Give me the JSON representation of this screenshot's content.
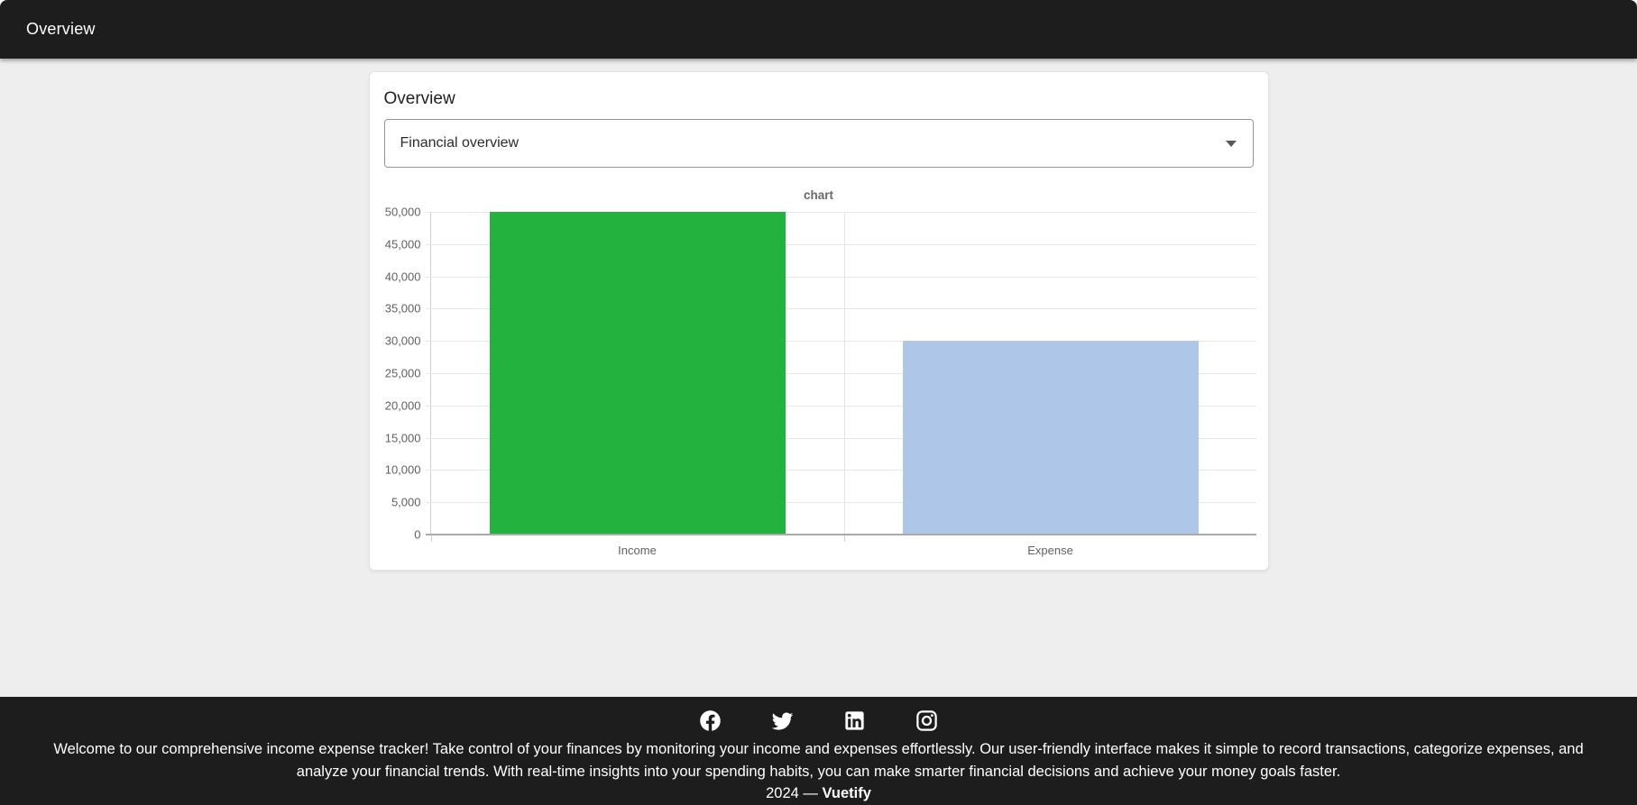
{
  "app_bar": {
    "title": "Overview"
  },
  "card": {
    "title": "Overview",
    "select": {
      "value": "Financial overview"
    }
  },
  "chart_data": {
    "type": "bar",
    "title": "chart",
    "categories": [
      "Income",
      "Expense"
    ],
    "values": [
      50000,
      30000
    ],
    "colors": [
      "#22b23d",
      "#aec6e8"
    ],
    "ylim": [
      0,
      50000
    ],
    "ytick_step": 5000,
    "ytick_labels": [
      "0",
      "5,000",
      "10,000",
      "15,000",
      "20,000",
      "25,000",
      "30,000",
      "35,000",
      "40,000",
      "45,000",
      "50,000"
    ],
    "grid": true,
    "legend": "none"
  },
  "footer": {
    "social_icons": [
      "facebook-icon",
      "twitter-icon",
      "linkedin-icon",
      "instagram-icon"
    ],
    "description": "Welcome to our comprehensive income expense tracker! Take control of your finances by monitoring your income and expenses effortlessly. Our user-friendly interface makes it simple to record transactions, categorize expenses, and analyze your financial trends. With real-time insights into your spending habits, you can make smarter financial decisions and achieve your money goals faster.",
    "copyright": {
      "year": "2024",
      "separator": "—",
      "brand": "Vuetify"
    }
  },
  "theme": {
    "app_bar_bg": "#1d1d1d",
    "footer_bg": "#1d1d1d",
    "page_bg": "#eeeeee",
    "card_bg": "#ffffff"
  }
}
